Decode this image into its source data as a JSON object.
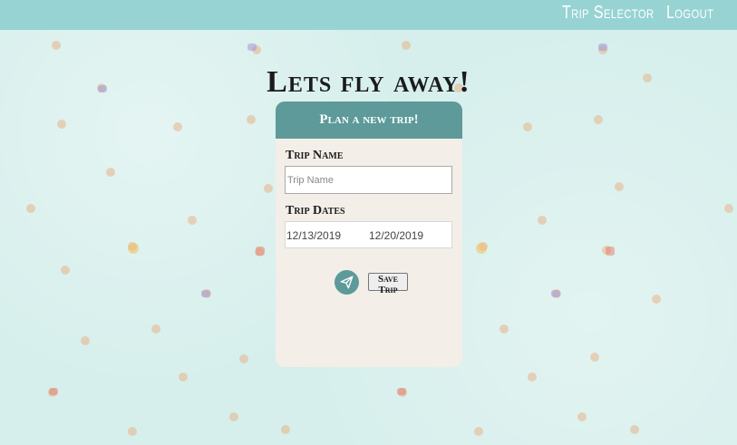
{
  "nav": {
    "trip_selector": "Trip Selector",
    "logout": "Logout"
  },
  "page_title": "Lets fly away!",
  "form": {
    "header": "Plan a new trip!",
    "trip_name_label": "Trip Name",
    "trip_name_placeholder": "Trip Name",
    "trip_dates_label": "Trip Dates",
    "start_date": "12/13/2019",
    "end_date": "12/20/2019",
    "send_icon": "paper-plane-icon",
    "save_label": "Save Trip"
  },
  "colors": {
    "navbar": "#97d3d3",
    "background": "#d6efec",
    "card": "#f3eee8",
    "accent": "#5d9a99"
  }
}
